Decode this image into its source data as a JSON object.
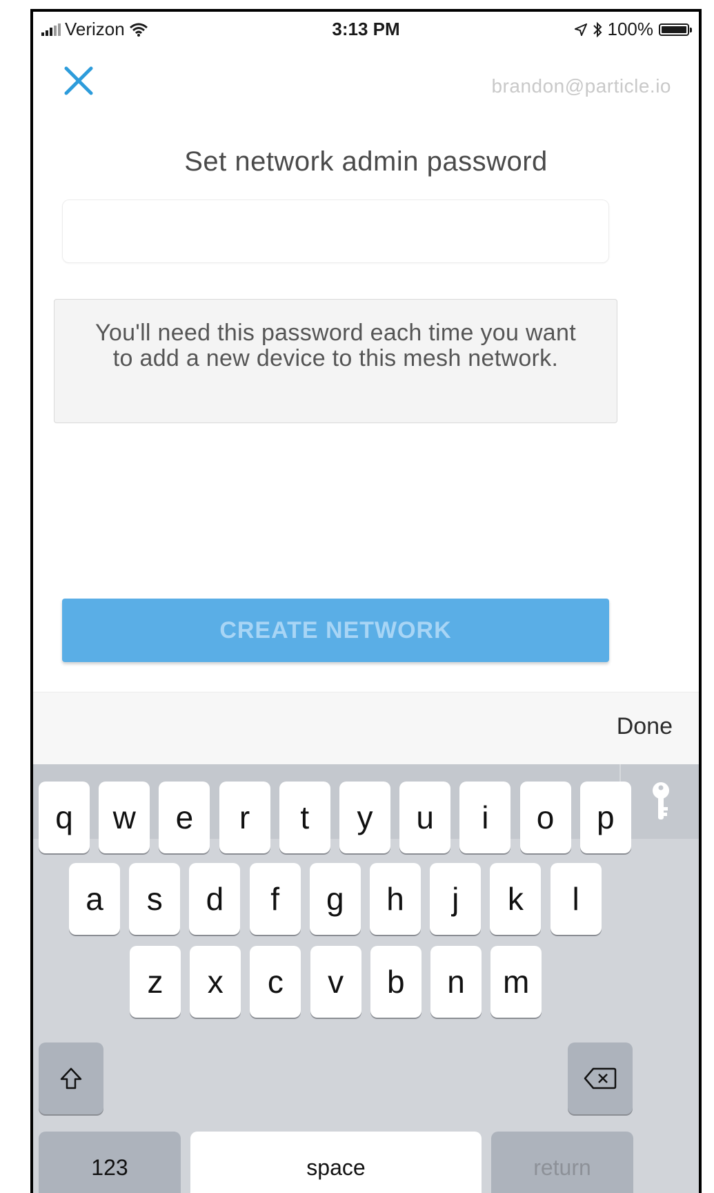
{
  "status_bar": {
    "carrier": "Verizon",
    "time": "3:13 PM",
    "battery": "100%",
    "battery_level": 1.0
  },
  "header": {
    "account_email": "brandon@particle.io"
  },
  "main": {
    "title": "Set network admin password",
    "password_value": "",
    "info_text": "You'll need this password each time you want to add a new device to this mesh network.",
    "create_button_label": "CREATE NETWORK"
  },
  "keyboard": {
    "done_label": "Done",
    "row1": [
      "q",
      "w",
      "e",
      "r",
      "t",
      "y",
      "u",
      "i",
      "o",
      "p"
    ],
    "row2": [
      "a",
      "s",
      "d",
      "f",
      "g",
      "h",
      "j",
      "k",
      "l"
    ],
    "row3": [
      "z",
      "x",
      "c",
      "v",
      "b",
      "n",
      "m"
    ],
    "numbers_label": "123",
    "space_label": "space",
    "return_label": "return"
  },
  "colors": {
    "accent": "#2d9cdb",
    "button_bg": "#5aaee6",
    "button_text": "#a8d5f5"
  }
}
